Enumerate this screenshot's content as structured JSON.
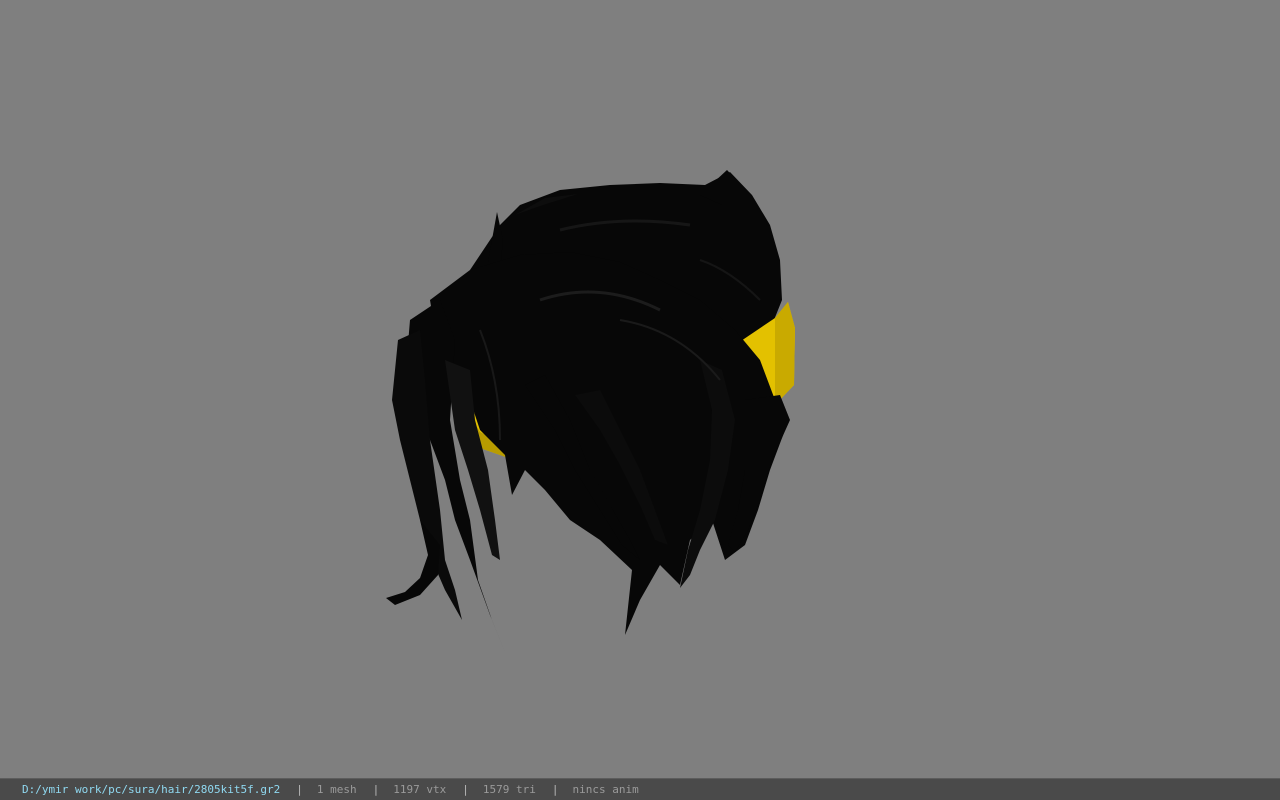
{
  "viewer": {
    "background_color": "#7f7f7f",
    "model_colors": {
      "hair": "#070707",
      "hair_highlight": "#1a1a1a",
      "band": "#e3c100",
      "band_shadow": "#9d8400"
    }
  },
  "statusbar": {
    "file_path": "D:/ymir work/pc/sura/hair/2805kit5f.gr2",
    "separator": "|",
    "mesh_count": "1 mesh",
    "vertex_count": "1197 vtx",
    "triangle_count": "1579 tri",
    "anim_status": "nincs anim"
  }
}
